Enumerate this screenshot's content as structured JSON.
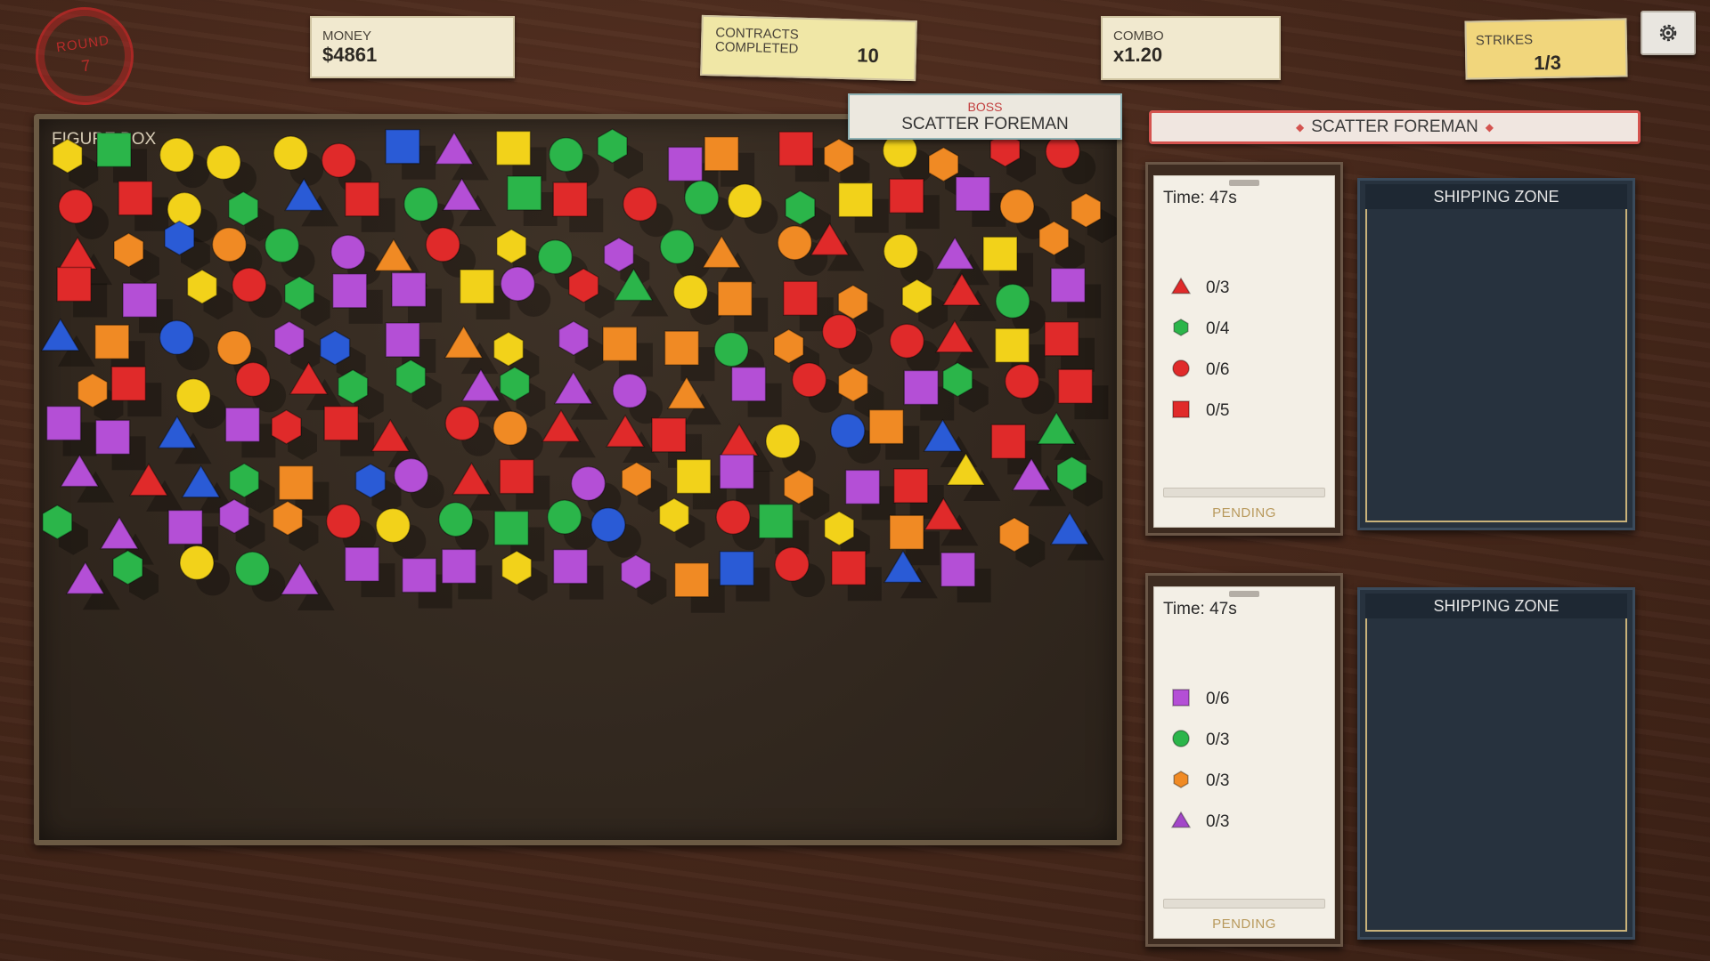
{
  "hud": {
    "round_label": "ROUND",
    "round_value": "7",
    "money_label": "MONEY",
    "money_value": "$4861",
    "contracts_label": "CONTRACTS COMPLETED",
    "contracts_value": "10",
    "combo_label": "COMBO",
    "combo_value": "x1.20",
    "strikes_label": "STRIKES",
    "strikes_value": "1/3",
    "settings_icon": "gear-icon"
  },
  "boss_tag": {
    "label": "BOSS",
    "name": "SCATTER FOREMAN"
  },
  "figure_box": {
    "label": "FIGURE BOX"
  },
  "boss_banner": {
    "name": "SCATTER FOREMAN"
  },
  "contracts": [
    {
      "time": "Time: 47s",
      "requirements": [
        {
          "shape": "triangle",
          "color": "#e02a2a",
          "count": "0/3"
        },
        {
          "shape": "hexagon",
          "color": "#2bb54a",
          "count": "0/4"
        },
        {
          "shape": "circle",
          "color": "#e02a2a",
          "count": "0/6"
        },
        {
          "shape": "square",
          "color": "#e02a2a",
          "count": "0/5"
        }
      ],
      "progress": 0,
      "status": "PENDING",
      "zone_label": "SHIPPING ZONE"
    },
    {
      "time": "Time: 47s",
      "requirements": [
        {
          "shape": "square",
          "color": "#b44fd6",
          "count": "0/6"
        },
        {
          "shape": "circle",
          "color": "#2bb54a",
          "count": "0/3"
        },
        {
          "shape": "hexagon",
          "color": "#f08a24",
          "count": "0/3"
        },
        {
          "shape": "triangle",
          "color": "#a347c9",
          "count": "0/3"
        }
      ],
      "progress": 0,
      "status": "PENDING",
      "zone_label": "SHIPPING ZONE"
    }
  ],
  "colors": {
    "red": "#e02a2a",
    "green": "#2bb54a",
    "yellow": "#f2d21a",
    "blue": "#2a5bd6",
    "purple": "#b44fd6",
    "orange": "#f08a24"
  },
  "figures": [
    [
      "hex",
      "yellow"
    ],
    [
      "sq",
      "green"
    ],
    [
      "ci",
      "yellow"
    ],
    [
      "ci",
      "yellow"
    ],
    [
      "ci",
      "yellow"
    ],
    [
      "ci",
      "red"
    ],
    [
      "sq",
      "blue"
    ],
    [
      "tri",
      "purple"
    ],
    [
      "sq",
      "yellow"
    ],
    [
      "ci",
      "green"
    ],
    [
      "hex",
      "green"
    ],
    [
      "sq",
      "purple"
    ],
    [
      "sq",
      "orange"
    ],
    [
      "sq",
      "red"
    ],
    [
      "hex",
      "orange"
    ],
    [
      "ci",
      "yellow"
    ],
    [
      "hex",
      "orange"
    ],
    [
      "hex",
      "red"
    ],
    [
      "ci",
      "red"
    ],
    [
      "ci",
      "red"
    ],
    [
      "sq",
      "red"
    ],
    [
      "ci",
      "yellow"
    ],
    [
      "hex",
      "green"
    ],
    [
      "tri",
      "blue"
    ],
    [
      "sq",
      "red"
    ],
    [
      "ci",
      "green"
    ],
    [
      "tri",
      "purple"
    ],
    [
      "sq",
      "green"
    ],
    [
      "sq",
      "red"
    ],
    [
      "ci",
      "red"
    ],
    [
      "ci",
      "green"
    ],
    [
      "ci",
      "yellow"
    ],
    [
      "hex",
      "green"
    ],
    [
      "sq",
      "yellow"
    ],
    [
      "sq",
      "red"
    ],
    [
      "sq",
      "purple"
    ],
    [
      "ci",
      "orange"
    ],
    [
      "hex",
      "orange"
    ],
    [
      "tri",
      "red"
    ],
    [
      "hex",
      "orange"
    ],
    [
      "hex",
      "blue"
    ],
    [
      "ci",
      "orange"
    ],
    [
      "ci",
      "green"
    ],
    [
      "ci",
      "purple"
    ],
    [
      "tri",
      "orange"
    ],
    [
      "ci",
      "red"
    ],
    [
      "hex",
      "yellow"
    ],
    [
      "ci",
      "green"
    ],
    [
      "hex",
      "purple"
    ],
    [
      "ci",
      "green"
    ],
    [
      "tri",
      "orange"
    ],
    [
      "ci",
      "orange"
    ],
    [
      "tri",
      "red"
    ],
    [
      "ci",
      "yellow"
    ],
    [
      "tri",
      "purple"
    ],
    [
      "sq",
      "yellow"
    ],
    [
      "hex",
      "orange"
    ],
    [
      "sq",
      "red"
    ],
    [
      "sq",
      "purple"
    ],
    [
      "hex",
      "yellow"
    ],
    [
      "ci",
      "red"
    ],
    [
      "hex",
      "green"
    ],
    [
      "sq",
      "purple"
    ],
    [
      "sq",
      "purple"
    ],
    [
      "sq",
      "yellow"
    ],
    [
      "ci",
      "purple"
    ],
    [
      "hex",
      "red"
    ],
    [
      "tri",
      "green"
    ],
    [
      "ci",
      "yellow"
    ],
    [
      "sq",
      "orange"
    ],
    [
      "sq",
      "red"
    ],
    [
      "hex",
      "orange"
    ],
    [
      "hex",
      "yellow"
    ],
    [
      "tri",
      "red"
    ],
    [
      "ci",
      "green"
    ],
    [
      "sq",
      "purple"
    ],
    [
      "tri",
      "blue"
    ],
    [
      "sq",
      "orange"
    ],
    [
      "ci",
      "blue"
    ],
    [
      "ci",
      "orange"
    ],
    [
      "hex",
      "purple"
    ],
    [
      "hex",
      "blue"
    ],
    [
      "sq",
      "purple"
    ],
    [
      "tri",
      "orange"
    ],
    [
      "hex",
      "yellow"
    ],
    [
      "hex",
      "purple"
    ],
    [
      "sq",
      "orange"
    ],
    [
      "sq",
      "orange"
    ],
    [
      "ci",
      "green"
    ],
    [
      "hex",
      "orange"
    ],
    [
      "ci",
      "red"
    ],
    [
      "ci",
      "red"
    ],
    [
      "tri",
      "red"
    ],
    [
      "sq",
      "yellow"
    ],
    [
      "sq",
      "red"
    ],
    [
      "hex",
      "orange"
    ],
    [
      "sq",
      "red"
    ],
    [
      "ci",
      "yellow"
    ],
    [
      "ci",
      "red"
    ],
    [
      "tri",
      "red"
    ],
    [
      "hex",
      "green"
    ],
    [
      "hex",
      "green"
    ],
    [
      "tri",
      "purple"
    ],
    [
      "hex",
      "green"
    ],
    [
      "tri",
      "purple"
    ],
    [
      "ci",
      "purple"
    ],
    [
      "tri",
      "orange"
    ],
    [
      "sq",
      "purple"
    ],
    [
      "ci",
      "red"
    ],
    [
      "hex",
      "orange"
    ],
    [
      "sq",
      "purple"
    ],
    [
      "hex",
      "green"
    ],
    [
      "ci",
      "red"
    ],
    [
      "sq",
      "red"
    ],
    [
      "sq",
      "purple"
    ],
    [
      "sq",
      "purple"
    ],
    [
      "tri",
      "blue"
    ],
    [
      "sq",
      "purple"
    ],
    [
      "hex",
      "red"
    ],
    [
      "sq",
      "red"
    ],
    [
      "tri",
      "red"
    ],
    [
      "ci",
      "red"
    ],
    [
      "ci",
      "orange"
    ],
    [
      "tri",
      "red"
    ],
    [
      "tri",
      "red"
    ],
    [
      "sq",
      "red"
    ],
    [
      "tri",
      "red"
    ],
    [
      "ci",
      "yellow"
    ],
    [
      "ci",
      "blue"
    ],
    [
      "sq",
      "orange"
    ],
    [
      "tri",
      "blue"
    ],
    [
      "sq",
      "red"
    ],
    [
      "tri",
      "green"
    ],
    [
      "tri",
      "purple"
    ],
    [
      "tri",
      "red"
    ],
    [
      "tri",
      "blue"
    ],
    [
      "hex",
      "green"
    ],
    [
      "sq",
      "orange"
    ],
    [
      "hex",
      "blue"
    ],
    [
      "ci",
      "purple"
    ],
    [
      "tri",
      "red"
    ],
    [
      "sq",
      "red"
    ],
    [
      "ci",
      "purple"
    ],
    [
      "hex",
      "orange"
    ],
    [
      "sq",
      "yellow"
    ],
    [
      "sq",
      "purple"
    ],
    [
      "hex",
      "orange"
    ],
    [
      "sq",
      "purple"
    ],
    [
      "sq",
      "red"
    ],
    [
      "tri",
      "yellow"
    ],
    [
      "tri",
      "purple"
    ],
    [
      "hex",
      "green"
    ],
    [
      "hex",
      "green"
    ],
    [
      "tri",
      "purple"
    ],
    [
      "sq",
      "purple"
    ],
    [
      "hex",
      "purple"
    ],
    [
      "hex",
      "orange"
    ],
    [
      "ci",
      "red"
    ],
    [
      "ci",
      "yellow"
    ],
    [
      "ci",
      "green"
    ],
    [
      "sq",
      "green"
    ],
    [
      "ci",
      "green"
    ],
    [
      "ci",
      "blue"
    ],
    [
      "hex",
      "yellow"
    ],
    [
      "ci",
      "red"
    ],
    [
      "sq",
      "green"
    ],
    [
      "hex",
      "yellow"
    ],
    [
      "sq",
      "orange"
    ],
    [
      "tri",
      "red"
    ],
    [
      "hex",
      "orange"
    ],
    [
      "tri",
      "blue"
    ],
    [
      "tri",
      "purple"
    ],
    [
      "hex",
      "green"
    ],
    [
      "ci",
      "yellow"
    ],
    [
      "ci",
      "green"
    ],
    [
      "tri",
      "purple"
    ],
    [
      "sq",
      "purple"
    ],
    [
      "sq",
      "purple"
    ],
    [
      "sq",
      "purple"
    ],
    [
      "hex",
      "yellow"
    ],
    [
      "sq",
      "purple"
    ],
    [
      "hex",
      "purple"
    ],
    [
      "sq",
      "orange"
    ],
    [
      "sq",
      "blue"
    ],
    [
      "ci",
      "red"
    ],
    [
      "sq",
      "red"
    ],
    [
      "tri",
      "blue"
    ],
    [
      "sq",
      "purple"
    ]
  ]
}
